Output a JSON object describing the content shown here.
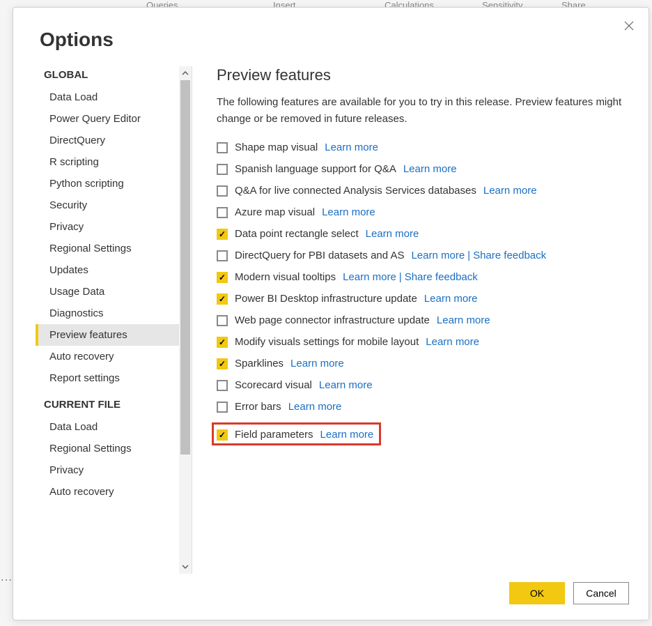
{
  "ribbon": {
    "queries": "Queries",
    "insert": "Insert",
    "calculations": "Calculations",
    "sensitivity": "Sensitivity",
    "share": "Share"
  },
  "dialog": {
    "title": "Options",
    "ok": "OK",
    "cancel": "Cancel"
  },
  "sidebar": {
    "global_header": "GLOBAL",
    "current_file_header": "CURRENT FILE",
    "global_items": [
      "Data Load",
      "Power Query Editor",
      "DirectQuery",
      "R scripting",
      "Python scripting",
      "Security",
      "Privacy",
      "Regional Settings",
      "Updates",
      "Usage Data",
      "Diagnostics",
      "Preview features",
      "Auto recovery",
      "Report settings"
    ],
    "current_file_items": [
      "Data Load",
      "Regional Settings",
      "Privacy",
      "Auto recovery"
    ],
    "selected": "Preview features"
  },
  "content": {
    "title": "Preview features",
    "description": "The following features are available for you to try in this release. Preview features might change or be removed in future releases.",
    "learn_more": "Learn more",
    "share_feedback": "Share feedback",
    "features": [
      {
        "label": "Shape map visual",
        "checked": false,
        "learn": true
      },
      {
        "label": "Spanish language support for Q&A",
        "checked": false,
        "learn": true
      },
      {
        "label": "Q&A for live connected Analysis Services databases",
        "checked": false,
        "learn": true
      },
      {
        "label": "Azure map visual",
        "checked": false,
        "learn": true
      },
      {
        "label": "Data point rectangle select",
        "checked": true,
        "learn": true
      },
      {
        "label": "DirectQuery for PBI datasets and AS",
        "checked": false,
        "learn": true,
        "feedback": true
      },
      {
        "label": "Modern visual tooltips",
        "checked": true,
        "learn": true,
        "feedback": true
      },
      {
        "label": "Power BI Desktop infrastructure update",
        "checked": true,
        "learn": true
      },
      {
        "label": "Web page connector infrastructure update",
        "checked": false,
        "learn": true
      },
      {
        "label": "Modify visuals settings for mobile layout",
        "checked": true,
        "learn": true
      },
      {
        "label": "Sparklines",
        "checked": true,
        "learn": true
      },
      {
        "label": "Scorecard visual",
        "checked": false,
        "learn": true
      },
      {
        "label": "Error bars",
        "checked": false,
        "learn": true
      },
      {
        "label": "Field parameters",
        "checked": true,
        "learn": true,
        "highlight": true
      }
    ]
  }
}
